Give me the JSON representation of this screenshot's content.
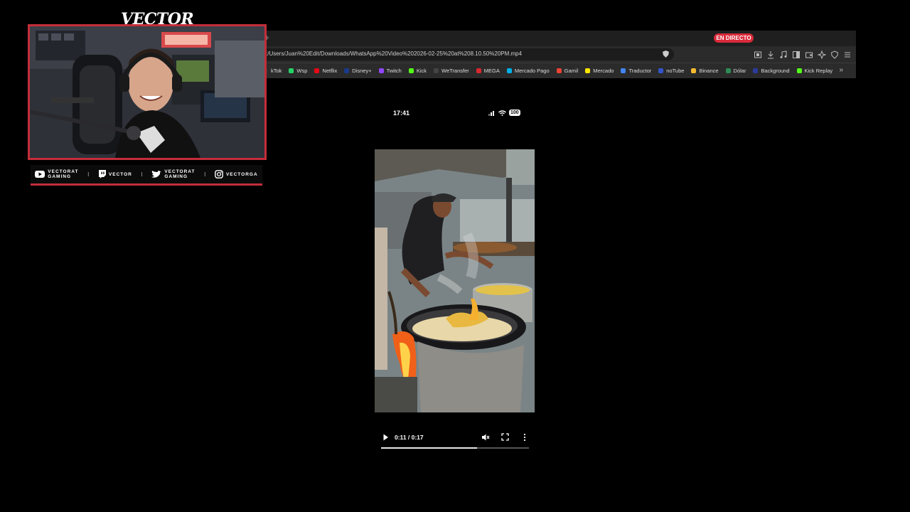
{
  "overlay": {
    "brand": "VECTOR",
    "socials": [
      {
        "icon": "youtube-icon",
        "line1": "VECTORAT",
        "line2": "GAMING"
      },
      {
        "icon": "twitch-icon",
        "line1": "",
        "line2": "VECTOR"
      },
      {
        "icon": "twitter-icon",
        "line1": "VECTORAT",
        "line2": "GAMING"
      },
      {
        "icon": "instagram-icon",
        "line1": "",
        "line2": "VECTORGA"
      }
    ],
    "separator": "I",
    "accent": "#c42d3a"
  },
  "browser": {
    "live_badge": "EN DIRECTO",
    "url": ":/Users/Juan%20Edit/Downloads/WhatsApp%20Video%202026-02-25%20at%208.10.50%20PM.mp4",
    "bookmarks": [
      {
        "label": "kTok",
        "color": "#333333"
      },
      {
        "label": "Wsp",
        "color": "#25d366"
      },
      {
        "label": "Netflix",
        "color": "#e50914"
      },
      {
        "label": "Disney+",
        "color": "#1a3a8a"
      },
      {
        "label": "Twitch",
        "color": "#9146ff"
      },
      {
        "label": "Kick",
        "color": "#53fc18"
      },
      {
        "label": "WeTransfer",
        "color": "#444444"
      },
      {
        "label": "MEGA",
        "color": "#d9272e"
      },
      {
        "label": "Mercado Pago",
        "color": "#00b1ea"
      },
      {
        "label": "Gamil",
        "color": "#ea4335"
      },
      {
        "label": "Mercado",
        "color": "#ffe600"
      },
      {
        "label": "Traductor",
        "color": "#4285f4"
      },
      {
        "label": "noTube",
        "color": "#3355cc"
      },
      {
        "label": "Binance",
        "color": "#f3ba2f"
      },
      {
        "label": "Dólar",
        "color": "#2e8b57"
      },
      {
        "label": "Background",
        "color": "#2b3a9a"
      },
      {
        "label": "Kick Replay",
        "color": "#53fc18"
      }
    ],
    "more": "»"
  },
  "phone": {
    "time": "17:41",
    "battery": "100"
  },
  "player": {
    "time": "0:11 / 0:17",
    "progress": 0.65
  }
}
